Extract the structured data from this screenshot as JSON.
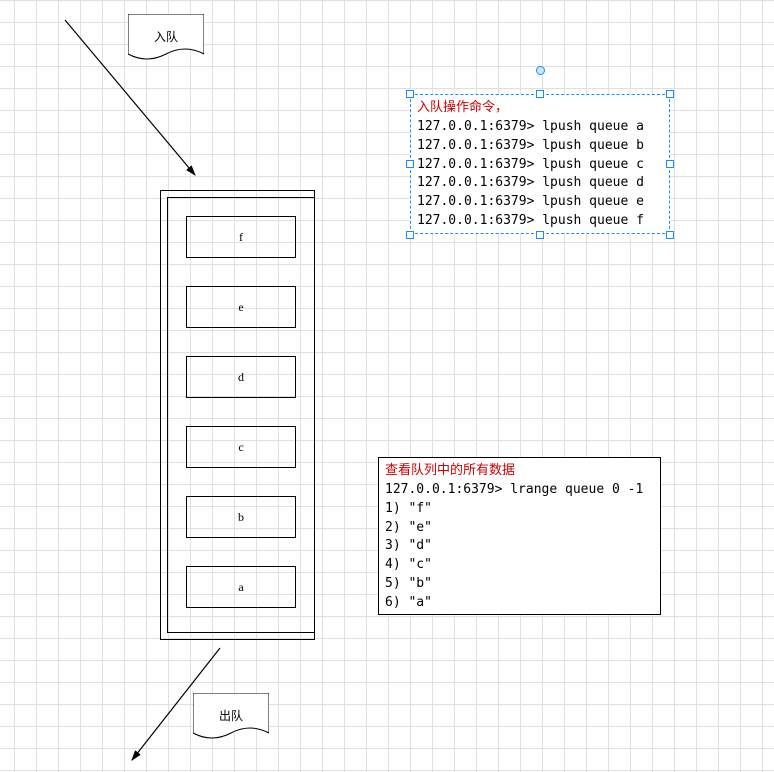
{
  "flags": {
    "enqueue": "入队",
    "dequeue": "出队"
  },
  "stack": {
    "cells": [
      "f",
      "e",
      "d",
      "c",
      "b",
      "a"
    ]
  },
  "box_push": {
    "title": "入队操作命令，",
    "lines": [
      "127.0.0.1:6379> lpush queue a",
      "127.0.0.1:6379> lpush queue b",
      "127.0.0.1:6379> lpush queue c",
      "127.0.0.1:6379> lpush queue d",
      "127.0.0.1:6379> lpush queue e",
      "127.0.0.1:6379> lpush queue f"
    ]
  },
  "box_range": {
    "title": "查看队列中的所有数据",
    "cmd": "127.0.0.1:6379> lrange queue 0 -1",
    "results": [
      "1) \"f\"",
      "2) \"e\"",
      "3) \"d\"",
      "4) \"c\"",
      "5) \"b\"",
      "6) \"a\""
    ]
  }
}
